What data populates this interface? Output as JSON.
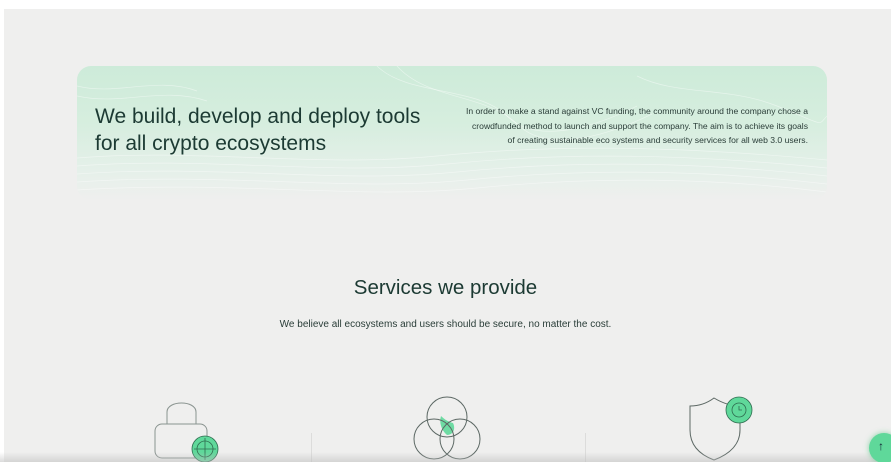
{
  "hero": {
    "title": "We build, develop and deploy tools for all crypto ecosystems",
    "description": "In order to make a stand against VC funding, the community around the company chose a crowdfunded method to launch and support the company. The aim is to achieve its goals of creating sustainable eco systems and security services for all web 3.0 users."
  },
  "services": {
    "title": "Services we provide",
    "subtitle": "We believe all ecosystems and users should be secure, no matter the cost.",
    "items": [
      {
        "icon": "lock-icon"
      },
      {
        "icon": "venn-circles-icon"
      },
      {
        "icon": "shield-clock-icon"
      }
    ]
  },
  "scroll_top": {
    "icon": "arrow-up-icon",
    "glyph": "↑"
  },
  "colors": {
    "accent": "#5fd89a",
    "hero_bg": "#cdebd9",
    "heading": "#1c3a33",
    "page_bg": "#efefee"
  }
}
